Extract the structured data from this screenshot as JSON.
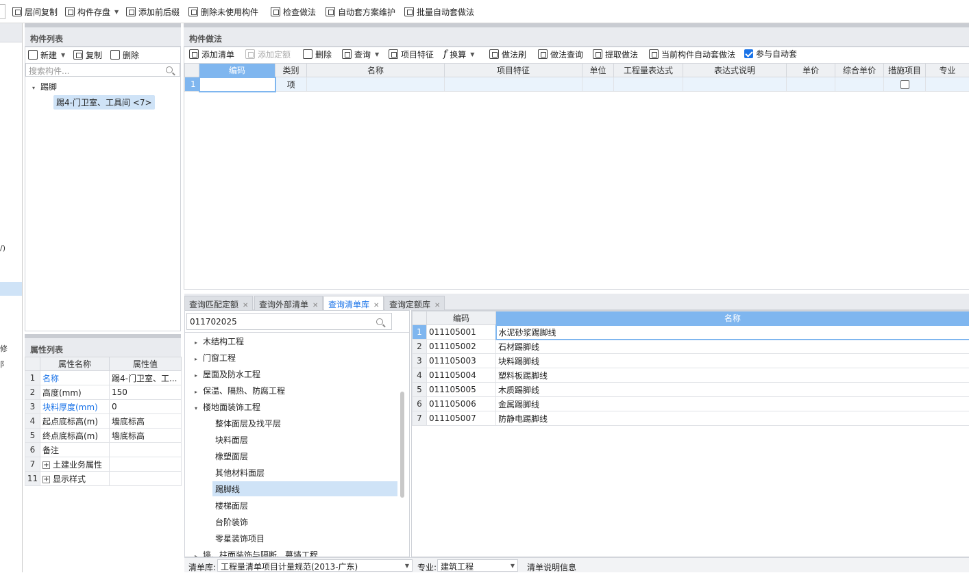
{
  "toolbar": {
    "items": [
      "层间复制",
      "构件存盘",
      "添加前后缀",
      "删除未使用构件",
      "检查做法",
      "自动套方案维护",
      "批量自动套做法"
    ]
  },
  "left_strip": {
    "texts": [
      "/)",
      "修",
      "阝"
    ]
  },
  "component_list": {
    "title": "构件列表",
    "new_label": "新建",
    "copy_label": "复制",
    "delete_label": "删除",
    "search_placeholder": "搜索构件...",
    "tree_parent": "踢脚",
    "tree_child": "踢4-门卫室、工具间 <7>"
  },
  "property_list": {
    "title": "属性列表",
    "col_name": "属性名称",
    "col_value": "属性值",
    "rows": [
      {
        "num": "1",
        "name": "名称",
        "value": "踢4-门卫室、工..."
      },
      {
        "num": "2",
        "name": "高度(mm)",
        "value": "150"
      },
      {
        "num": "3",
        "name": "块料厚度(mm)",
        "value": "0"
      },
      {
        "num": "4",
        "name": "起点底标高(m)",
        "value": "墙底标高"
      },
      {
        "num": "5",
        "name": "终点底标高(m)",
        "value": "墙底标高"
      },
      {
        "num": "6",
        "name": "备注",
        "value": ""
      },
      {
        "num": "7",
        "name": "土建业务属性",
        "value": ""
      },
      {
        "num": "11",
        "name": "显示样式",
        "value": ""
      }
    ]
  },
  "method_panel": {
    "title": "构件做法",
    "toolbar": [
      "添加清单",
      "添加定额",
      "删除",
      "查询",
      "项目特征",
      "换算",
      "做法刷",
      "做法查询",
      "提取做法",
      "当前构件自动套做法",
      "参与自动套"
    ],
    "columns": [
      "编码",
      "类别",
      "名称",
      "项目特征",
      "单位",
      "工程量表达式",
      "表达式说明",
      "单价",
      "综合单价",
      "措施项目",
      "专业"
    ],
    "row": {
      "num": "1",
      "category": "项"
    }
  },
  "tabs": [
    "查询匹配定额",
    "查询外部清单",
    "查询清单库",
    "查询定额库"
  ],
  "query": {
    "search_value": "011702025",
    "tree": [
      {
        "label": "木结构工程",
        "level": 0,
        "arrow": "▸"
      },
      {
        "label": "门窗工程",
        "level": 0,
        "arrow": "▸"
      },
      {
        "label": "屋面及防水工程",
        "level": 0,
        "arrow": "▸"
      },
      {
        "label": "保温、隔热、防腐工程",
        "level": 0,
        "arrow": "▸"
      },
      {
        "label": "楼地面装饰工程",
        "level": 0,
        "arrow": "▾"
      },
      {
        "label": "整体面层及找平层",
        "level": 1,
        "arrow": ""
      },
      {
        "label": "块料面层",
        "level": 1,
        "arrow": ""
      },
      {
        "label": "橡塑面层",
        "level": 1,
        "arrow": ""
      },
      {
        "label": "其他材料面层",
        "level": 1,
        "arrow": ""
      },
      {
        "label": "踢脚线",
        "level": 1,
        "arrow": ""
      },
      {
        "label": "楼梯面层",
        "level": 1,
        "arrow": ""
      },
      {
        "label": "台阶装饰",
        "level": 1,
        "arrow": ""
      },
      {
        "label": "零星装饰项目",
        "level": 1,
        "arrow": ""
      },
      {
        "label": "墙、柱面装饰与隔断、幕墙工程",
        "level": 0,
        "arrow": "▸"
      }
    ],
    "result_columns": [
      "编码",
      "名称"
    ],
    "results": [
      {
        "num": "1",
        "code": "011105001",
        "name": "水泥砂浆踢脚线"
      },
      {
        "num": "2",
        "code": "011105002",
        "name": "石材踢脚线"
      },
      {
        "num": "3",
        "code": "011105003",
        "name": "块料踢脚线"
      },
      {
        "num": "4",
        "code": "011105004",
        "name": "塑料板踢脚线"
      },
      {
        "num": "5",
        "code": "011105005",
        "name": "木质踢脚线"
      },
      {
        "num": "6",
        "code": "011105006",
        "name": "金属踢脚线"
      },
      {
        "num": "7",
        "code": "011105007",
        "name": "防静电踢脚线"
      }
    ]
  },
  "status": {
    "lib_label": "清单库:",
    "lib_value": "工程量清单项目计量规范(2013-广东)",
    "major_label": "专业:",
    "major_value": "建筑工程",
    "info_label": "清单说明信息"
  }
}
